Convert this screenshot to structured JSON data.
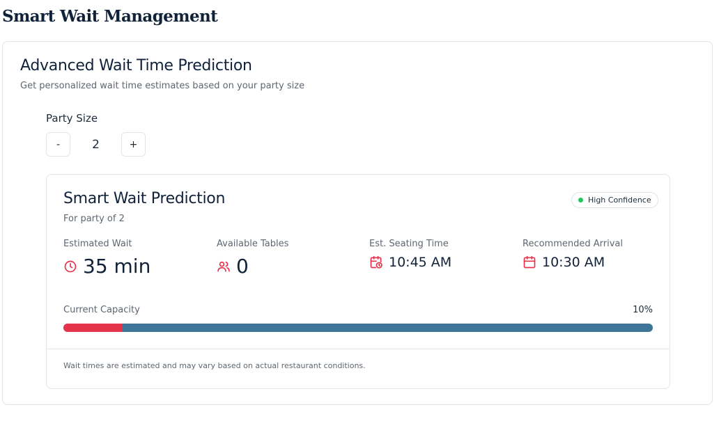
{
  "page": {
    "title": "Smart Wait Management"
  },
  "predictor": {
    "title": "Advanced Wait Time Prediction",
    "subtitle": "Get personalized wait time estimates based on your party size",
    "party_size_label": "Party Size",
    "decrement_label": "-",
    "increment_label": "+",
    "party_size": "2"
  },
  "prediction": {
    "title": "Smart Wait Prediction",
    "subtitle": "For party of 2",
    "badge": {
      "label": "High Confidence",
      "color": "#22c55e"
    },
    "stats": [
      {
        "label": "Estimated Wait",
        "value": "35 min",
        "icon": "clock-icon"
      },
      {
        "label": "Available Tables",
        "value": "0",
        "icon": "users-icon"
      },
      {
        "label": "Est. Seating Time",
        "value": "10:45 AM",
        "icon": "calendar-clock-icon"
      },
      {
        "label": "Recommended Arrival",
        "value": "10:30 AM",
        "icon": "calendar-icon"
      }
    ],
    "capacity": {
      "label": "Current Capacity",
      "percent_text": "10%",
      "percent": 10,
      "fill_color": "#e5334b",
      "track_color": "#3d7498"
    },
    "disclaimer": "Wait times are estimated and may vary based on actual restaurant conditions."
  },
  "colors": {
    "accent": "#e5334b",
    "heading": "#10223a"
  }
}
